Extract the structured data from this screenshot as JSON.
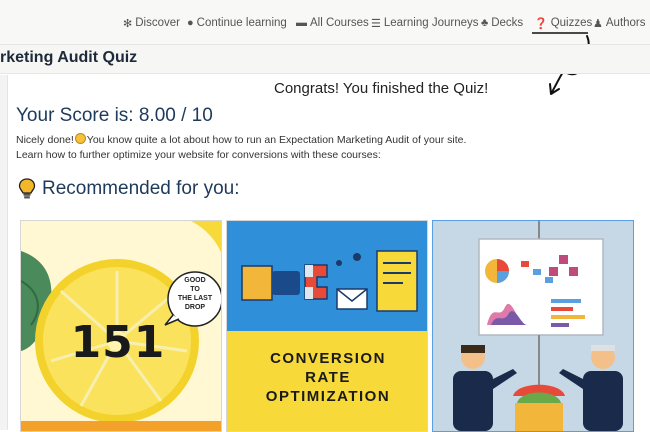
{
  "nav": {
    "items": [
      {
        "label": "Discover",
        "icon": "gear-icon"
      },
      {
        "label": "Continue learning",
        "icon": "play-circle-icon"
      },
      {
        "label": "All Courses",
        "icon": "book-icon"
      },
      {
        "label": "Learning Journeys",
        "icon": "signpost-icon"
      },
      {
        "label": "Decks",
        "icon": "sitemap-icon"
      },
      {
        "label": "Quizzes",
        "icon": "question-circle-icon"
      },
      {
        "label": "Authors",
        "icon": "users-icon"
      }
    ],
    "active": "Quizzes"
  },
  "page": {
    "title": "rketing Audit Quiz"
  },
  "result": {
    "congrats": "Congrats! You finished the Quiz!",
    "score_label": "Your Score is: 8.00 / 10",
    "line1_before": "Nicely done!",
    "line1_after": "You know quite a lot about how to run an Expectation Marketing Audit of your site.",
    "line2": "Learn how to further optimize your website for conversions with these courses:"
  },
  "recommended": {
    "heading": "Recommended for you:",
    "courses": [
      {
        "bubble_lines": [
          "GOOD",
          "TO",
          "THE LAST",
          "DROP"
        ],
        "number": "151"
      },
      {
        "title_lines": [
          "CONVERSION",
          "RATE",
          "OPTIMIZATION"
        ]
      },
      {
        "title_lines": []
      }
    ]
  },
  "colors": {
    "accent": "#1e3a5a",
    "nav_bg": "#f8f8f7",
    "lemon": "#f7d93a",
    "cro_blue": "#2f8fd8",
    "cro_yellow": "#f7d93a"
  }
}
